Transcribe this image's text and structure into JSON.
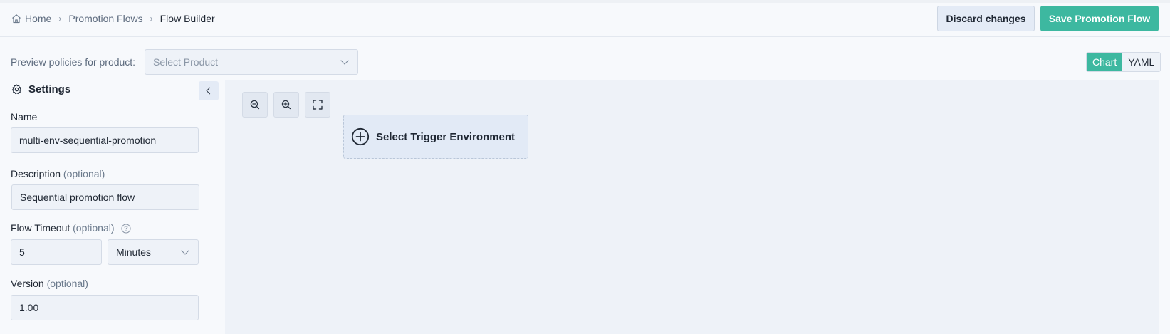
{
  "breadcrumb": {
    "home": "Home",
    "flows": "Promotion Flows",
    "current": "Flow Builder"
  },
  "actions": {
    "discard": "Discard changes",
    "save": "Save Promotion Flow"
  },
  "preview": {
    "label": "Preview policies for product:",
    "product_placeholder": "Select Product"
  },
  "view_toggle": {
    "chart": "Chart",
    "yaml": "YAML",
    "active": "Chart"
  },
  "settings": {
    "title": "Settings",
    "name_label": "Name",
    "name_value": "multi-env-sequential-promotion",
    "description_label": "Description",
    "description_optional": "(optional)",
    "description_value": "Sequential promotion flow",
    "timeout_label": "Flow Timeout",
    "timeout_optional": "(optional)",
    "timeout_value": "5",
    "timeout_unit": "Minutes",
    "version_label": "Version",
    "version_optional": "(optional)",
    "version_value": "1.00"
  },
  "canvas": {
    "trigger_label": "Select Trigger Environment"
  },
  "colors": {
    "accent": "#3db8a0",
    "background": "#f7f9fc",
    "canvas": "#eef2f8"
  },
  "icons": {
    "home": "home-icon",
    "settings": "gear-icon",
    "collapse": "chevron-left-icon",
    "help": "help-circle-icon",
    "zoom_out": "zoom-out-icon",
    "zoom_in": "zoom-in-icon",
    "fit": "fit-view-icon",
    "add": "plus-circle-icon"
  }
}
